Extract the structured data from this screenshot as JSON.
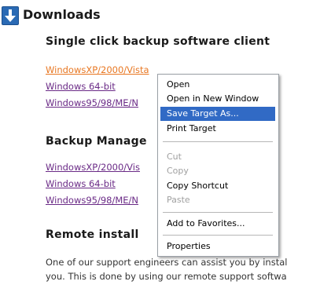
{
  "page": {
    "title": "Downloads",
    "section1": {
      "heading": "Single click backup software client",
      "links": [
        "WindowsXP/2000/Vista",
        "Windows 64-bit",
        "Windows95/98/ME/N"
      ]
    },
    "section2": {
      "heading": "Backup Manage",
      "links": [
        "WindowsXP/2000/Vis",
        "Windows 64-bit",
        "Windows95/98/ME/N"
      ]
    },
    "section3": {
      "heading": "Remote install",
      "para_line1": "One of our support engineers can assist you by instal",
      "para_line2": "you. This is done by using our remote support softwa"
    }
  },
  "context_menu": {
    "items": {
      "open": "Open",
      "open_new_window": "Open in New Window",
      "save_target": "Save Target As...",
      "print_target": "Print Target",
      "cut": "Cut",
      "copy": "Copy",
      "copy_shortcut": "Copy Shortcut",
      "paste": "Paste",
      "add_favorites": "Add to Favorites...",
      "properties": "Properties"
    }
  },
  "icons": {
    "download": "download-arrow-icon"
  },
  "colors": {
    "link": "#6a2a86",
    "active_link": "#e87722",
    "menu_highlight": "#316ac5",
    "icon_blue": "#2a6ab4"
  }
}
